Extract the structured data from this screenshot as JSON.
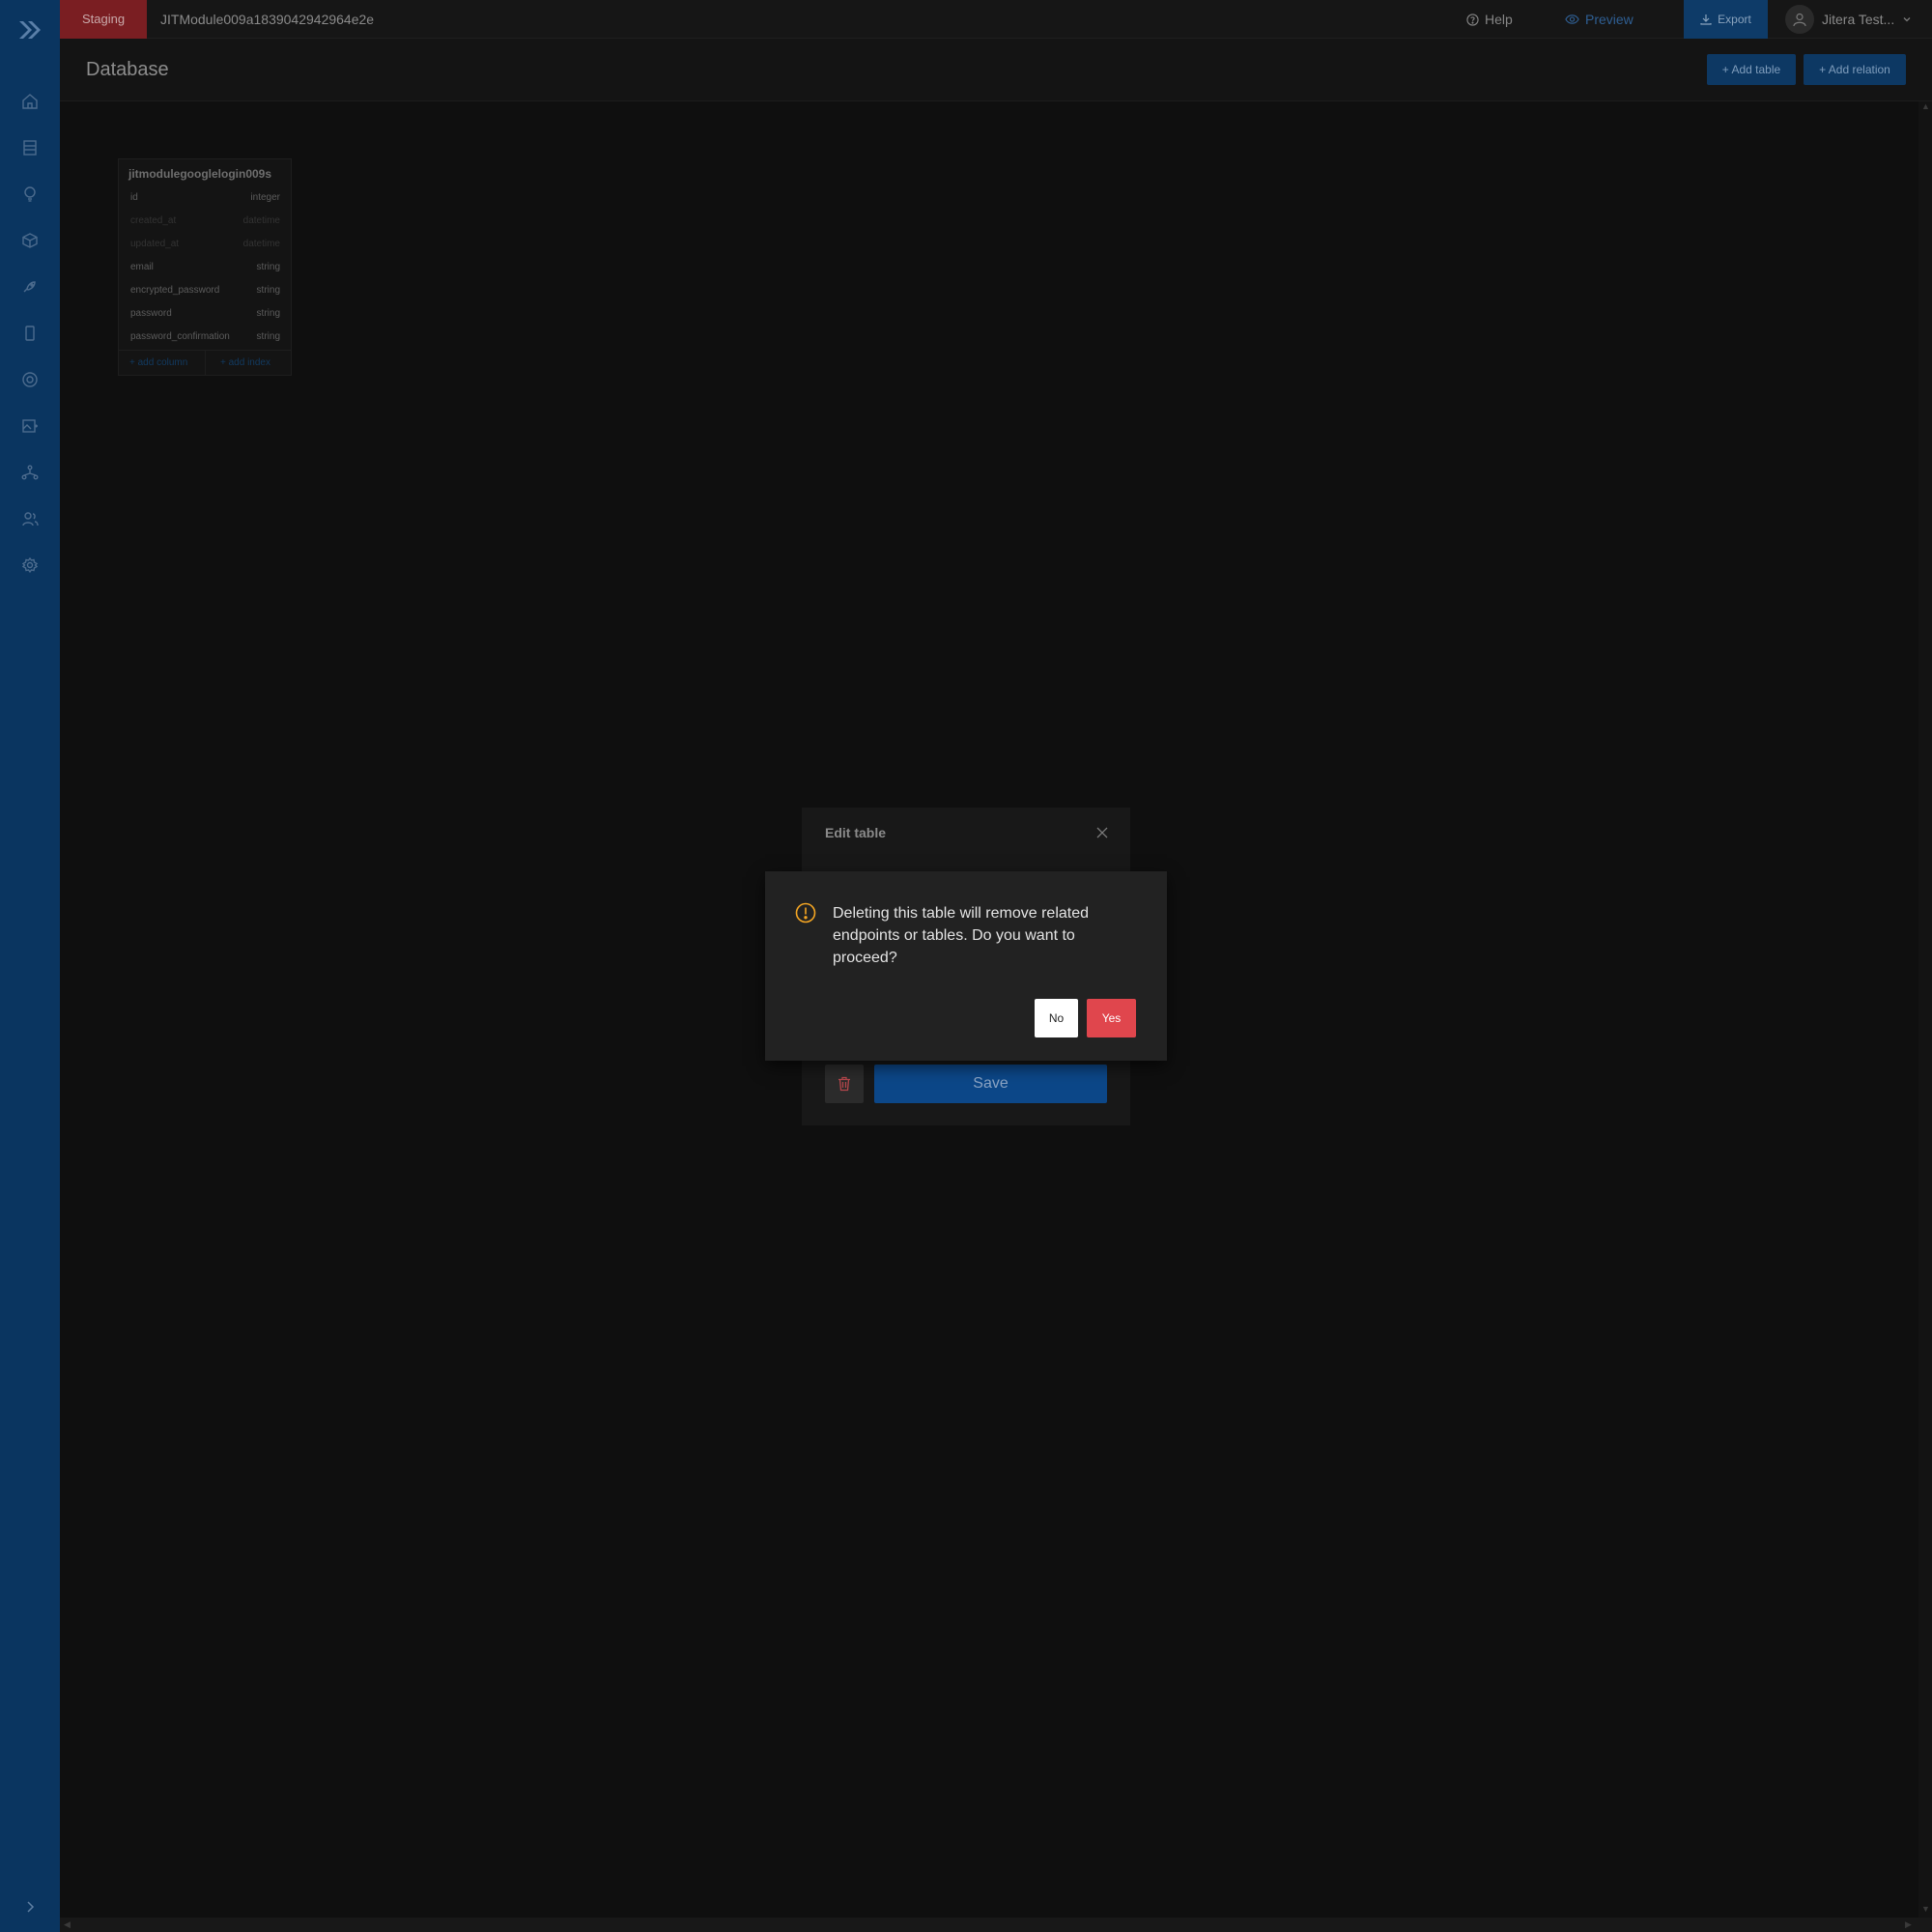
{
  "topbar": {
    "environment": "Staging",
    "project_name": "JITModule009a1839042942964e2e",
    "help_label": "Help",
    "preview_label": "Preview",
    "export_label": "Export",
    "user_name": "Jitera Test..."
  },
  "sidebar": {
    "icons": [
      "home-icon",
      "list-icon",
      "bulb-icon",
      "box-icon",
      "rocket-icon",
      "mobile-icon",
      "palette-icon",
      "image-icon",
      "network-icon",
      "team-icon",
      "settings-icon"
    ]
  },
  "header": {
    "title": "Database",
    "add_table_label": "+ Add table",
    "add_relation_label": "+ Add relation"
  },
  "table_card": {
    "name": "jitmodulegooglelogin009s",
    "columns": [
      {
        "name": "id",
        "type": "integer"
      },
      {
        "name": "created_at",
        "type": "datetime"
      },
      {
        "name": "updated_at",
        "type": "datetime"
      },
      {
        "name": "email",
        "type": "string"
      },
      {
        "name": "encrypted_password",
        "type": "string"
      },
      {
        "name": "password",
        "type": "string"
      },
      {
        "name": "password_confirmation",
        "type": "string"
      }
    ],
    "add_column_label": "+ add column",
    "add_index_label": "+ add index"
  },
  "edit_modal": {
    "title": "Edit table",
    "save_label": "Save"
  },
  "confirm": {
    "message": "Deleting this table will remove related endpoints or tables. Do you want to proceed?",
    "no_label": "No",
    "yes_label": "Yes"
  },
  "colors": {
    "sidebar": "#0a3560",
    "danger": "#e0464d",
    "warning": "#f5a623",
    "primary": "#0c4788"
  }
}
